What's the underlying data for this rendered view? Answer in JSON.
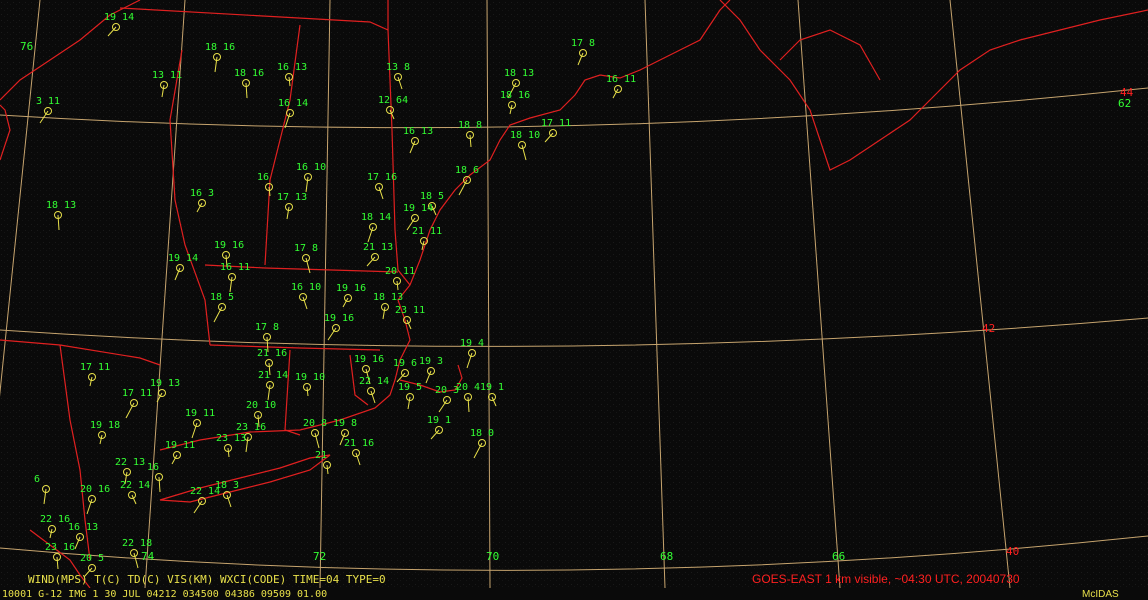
{
  "footer": {
    "legend": "WIND(MPS) T(C) TD(C) VIS(KM) WXCI(CODE)  TIME=04 TYPE=0",
    "caption": "GOES-EAST 1 km visible, ~04:30 UTC, 20040730",
    "status_line": "0001 G-12 IMG   1 30 JUL 04212 034500 04386 09509 01.00",
    "frame_number": "1",
    "logo": "McIDAS"
  },
  "grid_labels": {
    "lon": [
      "76",
      "74",
      "72",
      "70",
      "68",
      "66"
    ],
    "lat": [
      "44",
      "62",
      "42",
      "40"
    ]
  },
  "colors": {
    "coast": "#e02020",
    "grid": "#f0c070",
    "station_text": "#33ff33",
    "barb": "#e8e04a",
    "caption": "#ff2020"
  },
  "stations": [
    {
      "t": "19",
      "td": "14"
    },
    {
      "t": "17",
      "td": "8"
    },
    {
      "t": "18",
      "td": "16"
    },
    {
      "t": "16",
      "td": "13"
    },
    {
      "t": "13",
      "td": "8"
    },
    {
      "t": "18",
      "td": "13"
    },
    {
      "t": "16",
      "td": "11"
    },
    {
      "t": "13",
      "td": "11"
    },
    {
      "t": "18",
      "td": "16"
    },
    {
      "t": "12",
      "td": "64"
    },
    {
      "t": "3",
      "td": "11"
    },
    {
      "t": "16",
      "td": "14"
    },
    {
      "t": "18",
      "td": "16"
    },
    {
      "t": "18",
      "td": "8"
    },
    {
      "t": "18",
      "td": "10"
    },
    {
      "t": "17",
      "td": "11"
    },
    {
      "t": "16",
      "td": "13"
    },
    {
      "t": "16",
      "td": "10"
    },
    {
      "t": "16",
      "td": ""
    },
    {
      "t": "17",
      "td": "16"
    },
    {
      "t": "18",
      "td": "6"
    },
    {
      "t": "16",
      "td": "3"
    },
    {
      "t": "17",
      "td": "13"
    },
    {
      "t": "18",
      "td": "13"
    },
    {
      "t": "18",
      "td": "5"
    },
    {
      "t": "19",
      "td": "14"
    },
    {
      "t": "18",
      "td": "14"
    },
    {
      "t": "21",
      "td": "11"
    },
    {
      "t": "19",
      "td": "16"
    },
    {
      "t": "17",
      "td": "8"
    },
    {
      "t": "21",
      "td": "13"
    },
    {
      "t": "19",
      "td": "14"
    },
    {
      "t": "16",
      "td": "11"
    },
    {
      "t": "20",
      "td": "11"
    },
    {
      "t": "16",
      "td": "10"
    },
    {
      "t": "18",
      "td": "5"
    },
    {
      "t": "19",
      "td": "16"
    },
    {
      "t": "18",
      "td": "13"
    },
    {
      "t": "17",
      "td": "8"
    },
    {
      "t": "23",
      "td": "11"
    },
    {
      "t": "19",
      "td": "16"
    },
    {
      "t": "19",
      "td": "4"
    },
    {
      "t": "17",
      "td": "11"
    },
    {
      "t": "21",
      "td": "16"
    },
    {
      "t": "19",
      "td": "16"
    },
    {
      "t": "19",
      "td": "6"
    },
    {
      "t": "19",
      "td": "3"
    },
    {
      "t": "21",
      "td": "14"
    },
    {
      "t": "19",
      "td": "10"
    },
    {
      "t": "22",
      "td": "14"
    },
    {
      "t": "17",
      "td": "11"
    },
    {
      "t": "19",
      "td": "13"
    },
    {
      "t": "19",
      "td": "5"
    },
    {
      "t": "20",
      "td": "4"
    },
    {
      "t": "19",
      "td": "1"
    },
    {
      "t": "20",
      "td": "3"
    },
    {
      "t": "19",
      "td": "11"
    },
    {
      "t": "19",
      "td": "18"
    },
    {
      "t": "20",
      "td": "10"
    },
    {
      "t": "20",
      "td": "8"
    },
    {
      "t": "19",
      "td": "1"
    },
    {
      "t": "19",
      "td": "8"
    },
    {
      "t": "23",
      "td": "16"
    },
    {
      "t": "23",
      "td": "13"
    },
    {
      "t": "21",
      "td": "16"
    },
    {
      "t": "18",
      "td": "0"
    },
    {
      "t": "19",
      "td": "11"
    },
    {
      "t": "22",
      "td": "13"
    },
    {
      "t": "16",
      "td": ""
    },
    {
      "t": "22",
      "td": "14"
    },
    {
      "t": "22",
      "td": "14"
    },
    {
      "t": "20",
      "td": "16"
    },
    {
      "t": "22",
      "td": "16"
    },
    {
      "t": "23",
      "td": "16"
    },
    {
      "t": "22",
      "td": "18"
    },
    {
      "t": "20",
      "td": "5"
    },
    {
      "t": "16",
      "td": "13"
    },
    {
      "t": "6",
      "td": ""
    },
    {
      "t": "21",
      "td": ""
    },
    {
      "t": "18",
      "td": "3"
    }
  ]
}
